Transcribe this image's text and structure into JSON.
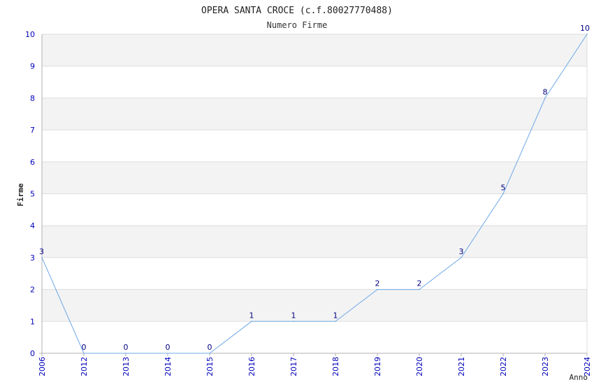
{
  "chart_data": {
    "type": "line",
    "title": "OPERA SANTA CROCE (c.f.80027770488)",
    "subtitle": "Numero Firme",
    "xlabel": "Anno",
    "ylabel": "Firme",
    "categories": [
      "2006",
      "2012",
      "2013",
      "2014",
      "2015",
      "2016",
      "2017",
      "2018",
      "2019",
      "2020",
      "2021",
      "2022",
      "2023",
      "2024"
    ],
    "series": [
      {
        "values": [
          3,
          0,
          0,
          0,
          0,
          1,
          1,
          1,
          2,
          2,
          3,
          5,
          8,
          10
        ]
      }
    ],
    "ylim": [
      0,
      10
    ],
    "yticks": [
      0,
      1,
      2,
      3,
      4,
      5,
      6,
      7,
      8,
      9,
      10
    ],
    "grid": true,
    "legend": "none",
    "colors": {
      "line": "#6fa8e6",
      "tick_label": "#0000bb",
      "data_label": "#000080",
      "band": "#f3f3f3",
      "grid": "#dddddd",
      "axis": "#b0b0b0",
      "title": "#222222"
    }
  }
}
